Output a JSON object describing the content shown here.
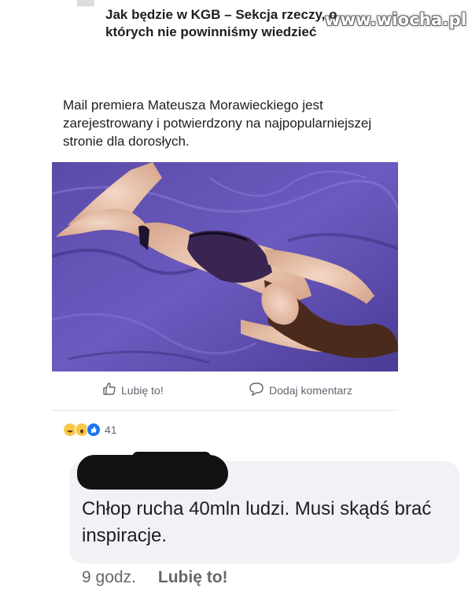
{
  "watermark": "www.wiocha.pl",
  "group": {
    "title": "Jak będzie w KGB – Sekcja rzeczy, o których nie powinniśmy wiedzieć"
  },
  "post": {
    "text": "Mail premiera Mateusza Morawieckiego jest zarejestrowany i potwierdzony na najpopularniejszej stronie dla dorosłych."
  },
  "actions": {
    "like_label": "Lubię to!",
    "comment_label": "Dodaj komentarz"
  },
  "reactions": {
    "icons": [
      "haha-icon",
      "wow-icon",
      "like-icon"
    ],
    "count": "41"
  },
  "comment": {
    "text": "Chłop rucha 40mln ludzi. Musi skądś brać inspiracje.",
    "time": "9 godz.",
    "like_label": "Lubię to!"
  },
  "colors": {
    "fb_blue": "#1877f2",
    "text": "#1c1e21",
    "muted": "#65676b",
    "bubble": "#f0f2f5"
  }
}
